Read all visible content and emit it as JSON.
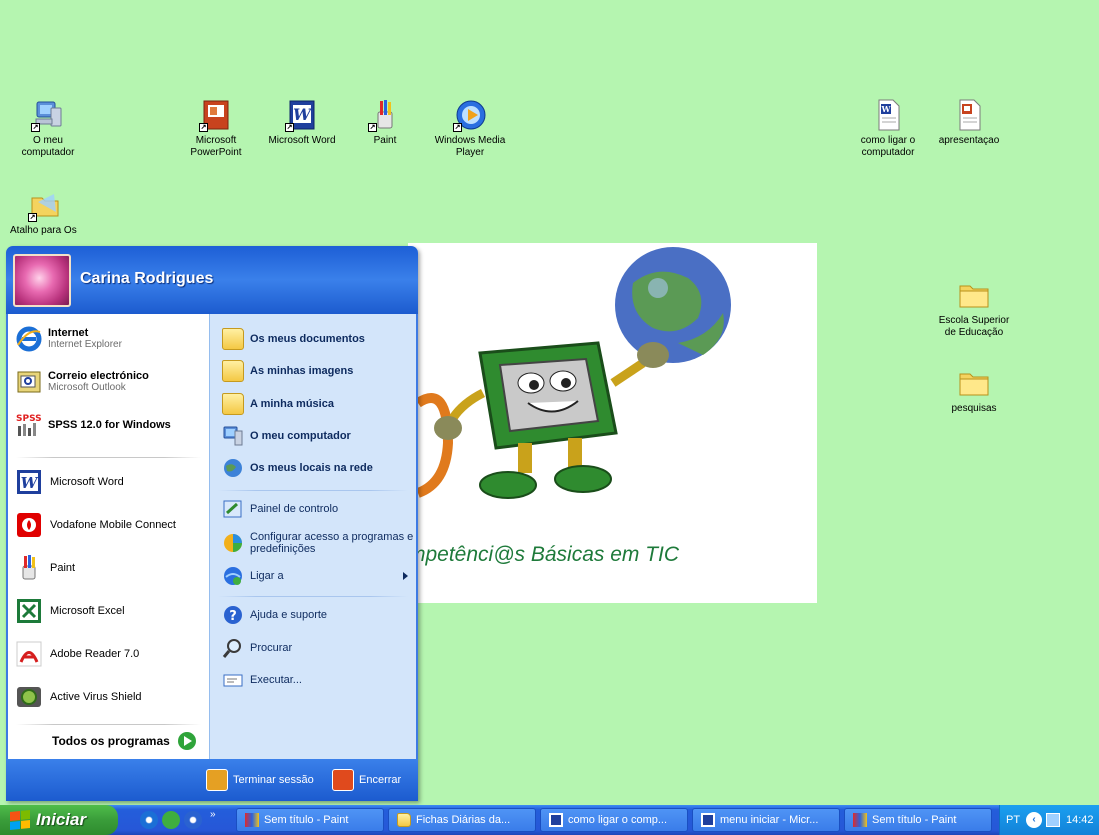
{
  "desktop": {
    "icons": [
      {
        "label": "O meu computador",
        "icon": "my-computer-icon"
      },
      {
        "label": "Microsoft PowerPoint",
        "icon": "powerpoint-icon"
      },
      {
        "label": "Microsoft Word",
        "icon": "word-icon"
      },
      {
        "label": "Paint",
        "icon": "paint-icon"
      },
      {
        "label": "Windows Media Player",
        "icon": "media-player-icon"
      },
      {
        "label": "como ligar o computador",
        "icon": "word-document-icon"
      },
      {
        "label": "apresentaçao",
        "icon": "powerpoint-document-icon"
      },
      {
        "label": "Atalho para Os",
        "icon": "shortcut-icon"
      },
      {
        "label": "Escola Superior de Educação",
        "icon": "folder-icon"
      },
      {
        "label": "pesquisas",
        "icon": "folder-icon"
      }
    ],
    "wallpaper_text": "mpetênci@s Básicas em TIC"
  },
  "start_menu": {
    "user": "Carina Rodrigues",
    "pinned": [
      {
        "title": "Internet",
        "subtitle": "Internet Explorer",
        "icon": "internet-explorer-icon"
      },
      {
        "title": "Correio electrónico",
        "subtitle": "Microsoft Outlook",
        "icon": "outlook-icon"
      },
      {
        "title": "SPSS 12.0 for Windows",
        "subtitle": "",
        "icon": "spss-icon"
      }
    ],
    "recent": [
      {
        "label": "Microsoft Word",
        "icon": "word-icon"
      },
      {
        "label": "Vodafone Mobile Connect",
        "icon": "vodafone-icon"
      },
      {
        "label": "Paint",
        "icon": "paint-icon"
      },
      {
        "label": "Microsoft Excel",
        "icon": "excel-icon"
      },
      {
        "label": "Adobe Reader 7.0",
        "icon": "adobe-reader-icon"
      },
      {
        "label": "Active Virus Shield",
        "icon": "virus-shield-icon"
      }
    ],
    "all_programs": "Todos os programas",
    "places": [
      {
        "label": "Os meus documentos",
        "icon": "documents-folder-icon"
      },
      {
        "label": "As minhas imagens",
        "icon": "pictures-folder-icon"
      },
      {
        "label": "A minha música",
        "icon": "music-folder-icon"
      },
      {
        "label": "O meu computador",
        "icon": "computer-icon"
      },
      {
        "label": "Os meus locais na rede",
        "icon": "network-icon"
      }
    ],
    "settings": [
      {
        "label": "Painel de controlo",
        "icon": "control-panel-icon"
      },
      {
        "label": "Configurar acesso a programas e predefinições",
        "icon": "program-access-icon"
      },
      {
        "label": "Ligar a",
        "icon": "connect-to-icon"
      }
    ],
    "help": [
      {
        "label": "Ajuda e suporte",
        "icon": "help-icon"
      },
      {
        "label": "Procurar",
        "icon": "search-icon"
      },
      {
        "label": "Executar...",
        "icon": "run-icon"
      }
    ],
    "logoff": "Terminar sessão",
    "shutdown": "Encerrar"
  },
  "taskbar": {
    "start_label": "Iniciar",
    "tasks": [
      {
        "label": "Sem título - Paint",
        "icon": "paint-icon"
      },
      {
        "label": "Fichas Diárias da...",
        "icon": "folder-icon"
      },
      {
        "label": "como ligar o comp...",
        "icon": "word-icon"
      },
      {
        "label": "menu iniciar - Micr...",
        "icon": "word-icon"
      },
      {
        "label": "Sem título - Paint",
        "icon": "paint-icon"
      }
    ],
    "language": "PT",
    "time": "14:42"
  }
}
